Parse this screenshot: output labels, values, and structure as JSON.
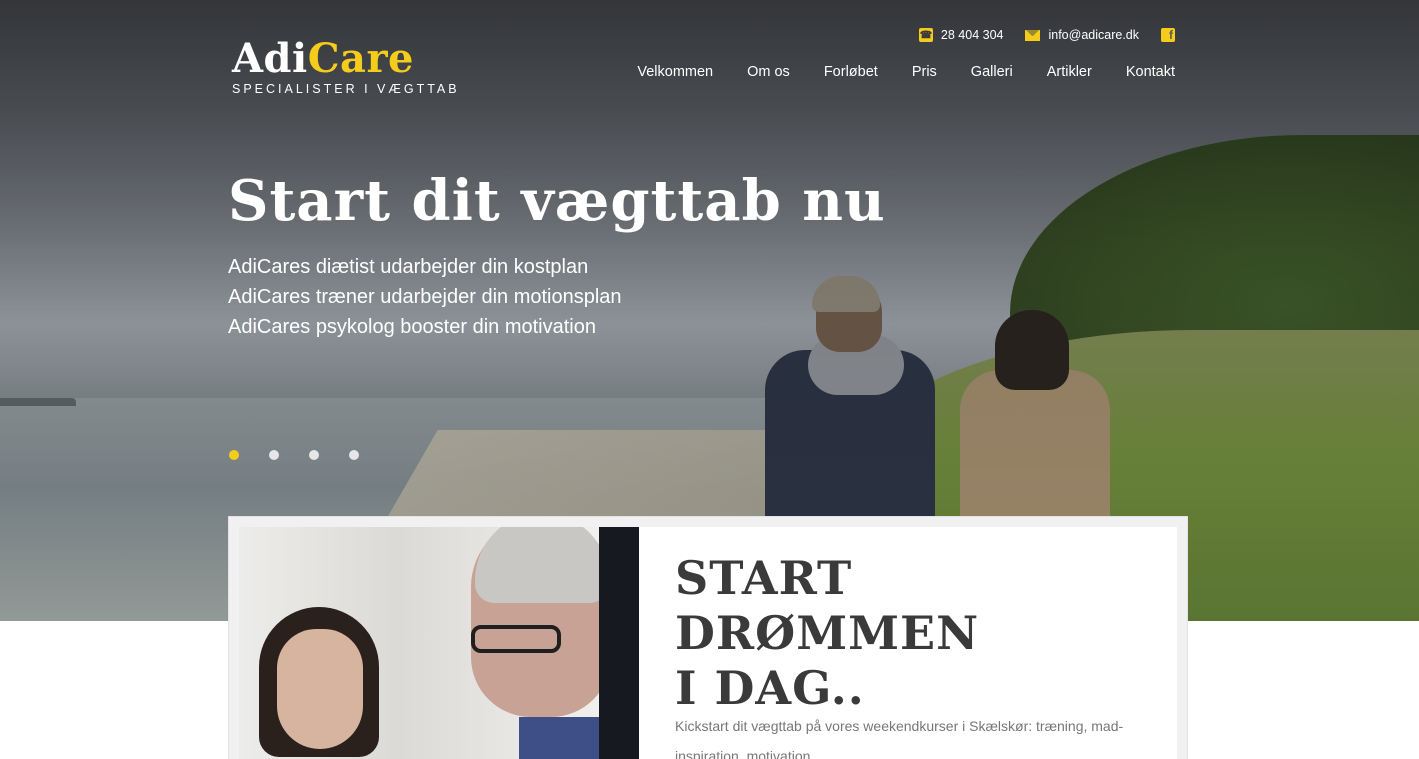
{
  "brand": {
    "name_part1": "Adi",
    "name_part2": "Care",
    "tagline": "SPECIALISTER I VÆGTTAB",
    "accent_color": "#f4cc1b"
  },
  "contact": {
    "phone": "28 404 304",
    "email": "info@adicare.dk",
    "phone_icon": "phone-icon",
    "email_icon": "envelope-icon",
    "social_icon": "facebook-icon"
  },
  "nav": {
    "items": [
      "Velkommen",
      "Om os",
      "Forløbet",
      "Pris",
      "Galleri",
      "Artikler",
      "Kontakt"
    ]
  },
  "hero": {
    "title": "Start dit vægttab nu",
    "lines": [
      "AdiCares diætist udarbejder din kostplan",
      "AdiCares træner udarbejder din motionsplan",
      "AdiCares psykolog booster din motivation"
    ],
    "slides": {
      "count": 4,
      "active_index": 0
    }
  },
  "feature": {
    "title_line1": "START DRØMMEN",
    "title_line2": "I DAG..",
    "text": "Kickstart dit vægttab på vores weekendkurser i Skælskør: træning, mad-inspiration, motivation."
  }
}
